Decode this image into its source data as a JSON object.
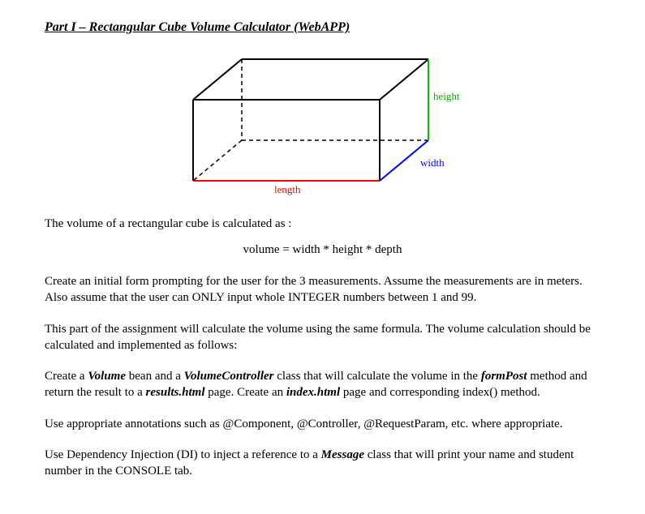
{
  "title": "Part I – Rectangular Cube Volume Calculator (WebAPP)",
  "diagram": {
    "label_height": "height",
    "label_width": "width",
    "label_length": "length"
  },
  "intro": "The volume of a rectangular cube is calculated as :",
  "formula": "volume = width * height * depth",
  "p1": "Create an initial form prompting for the user for the 3 measurements. Assume the measurements are in meters. Also assume that the user can ONLY input whole INTEGER numbers between 1 and 99.",
  "p2": "This part of the assignment will calculate the volume using the same formula. The volume calculation should be calculated and implemented as follows:",
  "p3": {
    "t1": "Create a ",
    "b1": "Volume",
    "t2": " bean and a ",
    "b2": "VolumeController",
    "t3": " class that will calculate the volume in the ",
    "b3": "formPost",
    "t4": " method and return the result to a ",
    "b4": "results.html",
    "t5": " page. Create an ",
    "b5": "index.html",
    "t6": " page and corresponding index() method."
  },
  "p4": "Use appropriate annotations such as @Component, @Controller, @RequestParam, etc. where appropriate.",
  "p5": {
    "t1": "Use Dependency Injection (DI) to inject a reference to a ",
    "b1": "Message",
    "t2": " class that will print your name and student number in the CONSOLE tab."
  }
}
